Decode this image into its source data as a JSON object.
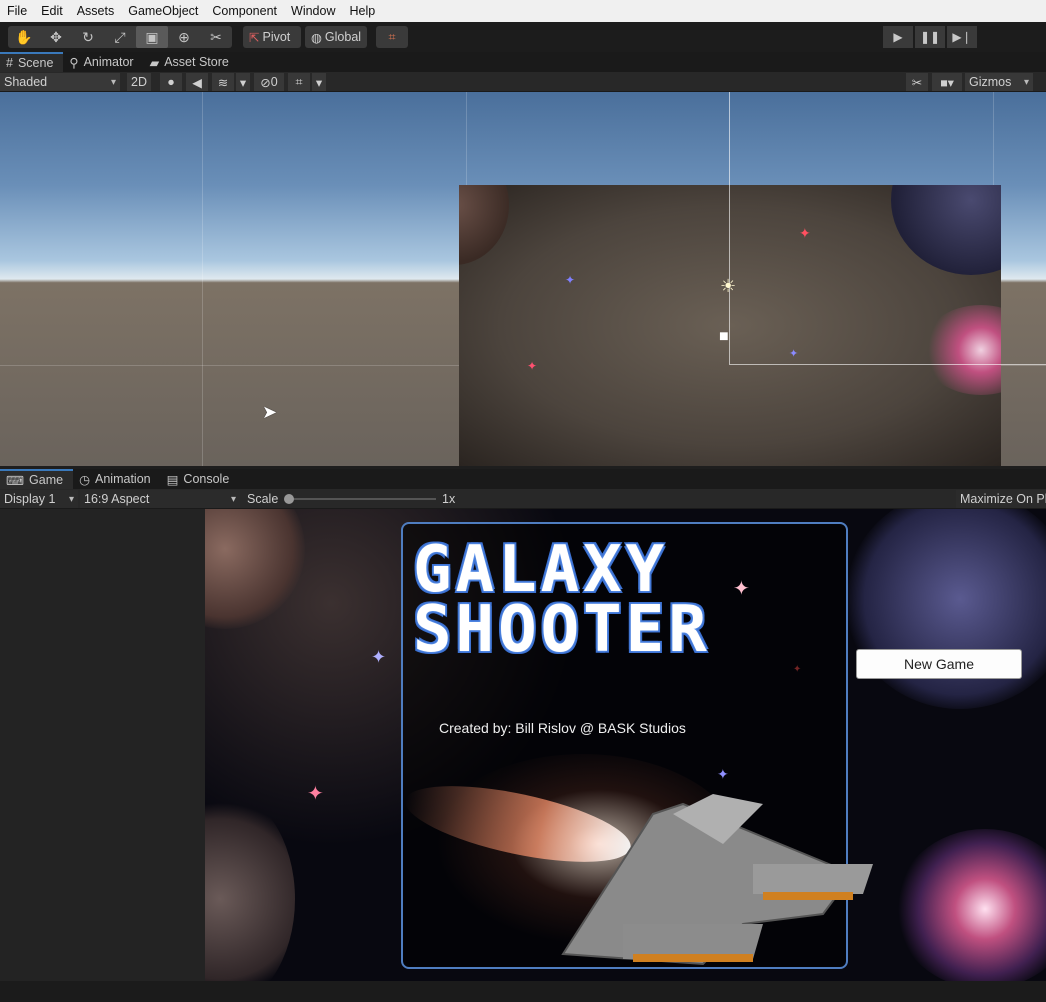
{
  "menu": [
    "File",
    "Edit",
    "Assets",
    "GameObject",
    "Component",
    "Window",
    "Help"
  ],
  "toolbar": {
    "pivot_label": "Pivot",
    "global_label": "Global"
  },
  "top_tabs": {
    "scene": "Scene",
    "animator": "Animator",
    "asset_store": "Asset Store"
  },
  "scene_controls": {
    "shading_mode": "Shaded",
    "mode_2d": "2D",
    "hidden_count": "0",
    "gizmos": "Gizmos"
  },
  "bottom_tabs": {
    "game": "Game",
    "animation": "Animation",
    "console": "Console"
  },
  "game_controls": {
    "display": "Display 1",
    "aspect": "16:9 Aspect",
    "scale_label": "Scale",
    "scale_value": "1x",
    "maximize": "Maximize On Pl"
  },
  "game_view": {
    "title_line1": "GALAXY",
    "title_line2": "SHOOTER",
    "credit": "Created by: Bill Rislov @ BASK Studios",
    "new_game_button": "New Game"
  },
  "colors": {
    "accent_blue": "#3a79bb",
    "panel_border": "#4f7dc0"
  }
}
